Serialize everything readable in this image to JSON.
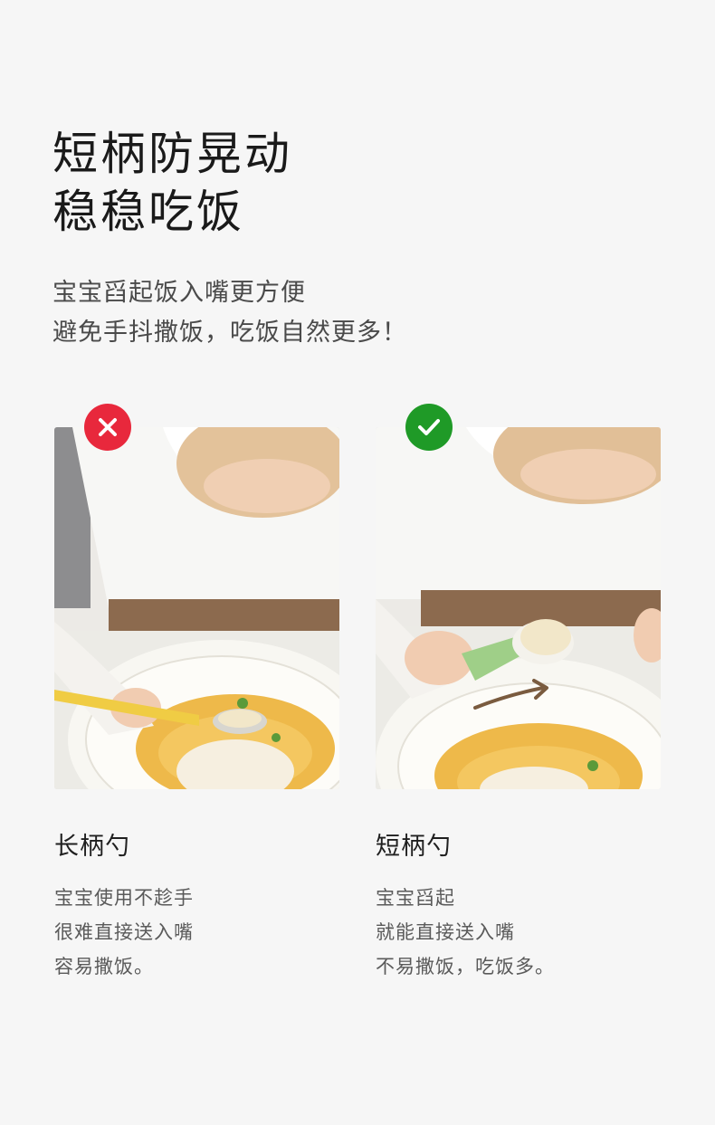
{
  "title": {
    "line1": "短柄防晃动",
    "line2": "稳稳吃饭"
  },
  "subtitle": {
    "line1": "宝宝舀起饭入嘴更方便",
    "line2": "避免手抖撒饭，吃饭自然更多！"
  },
  "left": {
    "badge_icon": "cross-icon",
    "badge_color": "#e8283c",
    "caption_title": "长柄勺",
    "caption_lines": [
      "宝宝使用不趁手",
      "很难直接送入嘴",
      "容易撒饭。"
    ]
  },
  "right": {
    "badge_icon": "check-icon",
    "badge_color": "#1f9a27",
    "caption_title": "短柄勺",
    "caption_lines": [
      "宝宝舀起",
      "就能直接送入嘴",
      "不易撒饭，吃饭多。"
    ]
  }
}
